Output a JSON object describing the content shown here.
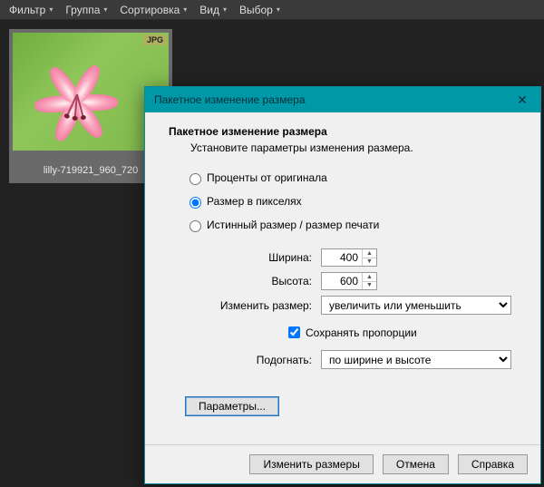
{
  "menubar": {
    "items": [
      "Фильтр",
      "Группа",
      "Сортировка",
      "Вид",
      "Выбор"
    ]
  },
  "thumb": {
    "badge": "JPG",
    "caption": "lilly-719921_960_720"
  },
  "dialog": {
    "title": "Пакетное изменение размера",
    "heading": "Пакетное изменение размера",
    "subheading": "Установите параметры изменения размера.",
    "radios": {
      "percent": "Проценты от оригинала",
      "pixels": "Размер в пикселях",
      "print": "Истинный размер / размер печати",
      "selected": "pixels"
    },
    "width_label": "Ширина:",
    "height_label": "Высота:",
    "width_value": "400",
    "height_value": "600",
    "resize_mode_label": "Изменить размер:",
    "resize_mode_value": "увеличить или уменьшить",
    "keep_ratio_label": "Сохранять пропорции",
    "keep_ratio_checked": true,
    "fit_label": "Подогнать:",
    "fit_value": "по ширине и высоте",
    "options_btn": "Параметры...",
    "buttons": {
      "apply": "Изменить размеры",
      "cancel": "Отмена",
      "help": "Справка"
    }
  }
}
